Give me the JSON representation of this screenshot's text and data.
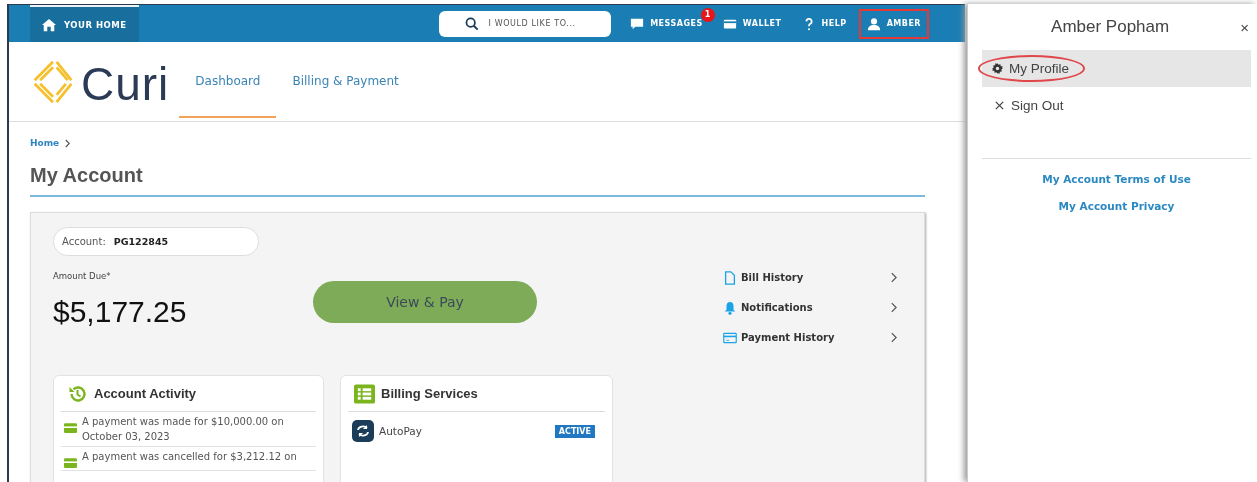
{
  "top_nav": {
    "home": "YOUR HOME",
    "search": {
      "placeholder": "I WOULD LIKE TO..."
    },
    "items": [
      {
        "kind": "messages",
        "label": "MESSAGES",
        "badge": "1",
        "annotated": false
      },
      {
        "kind": "wallet",
        "label": "WALLET",
        "annotated": false
      },
      {
        "kind": "help",
        "label": "HELP",
        "annotated": false
      },
      {
        "kind": "user",
        "label": "AMBER",
        "annotated": true
      }
    ]
  },
  "header": {
    "logo": "Curi",
    "tabs": [
      {
        "label": "Dashboard",
        "selected": true
      },
      {
        "label": "Billing & Payment",
        "selected": false
      }
    ]
  },
  "breadcrumb": [
    "Home"
  ],
  "page_title": "My Account",
  "account": {
    "label": "Account:",
    "number": "PG122845",
    "amount_label": "Amount Due*",
    "amount": "$5,177.25",
    "pay_button": "View & Pay",
    "links": [
      {
        "kind": "bill",
        "label": "Bill History"
      },
      {
        "kind": "bell",
        "label": "Notifications"
      },
      {
        "kind": "card",
        "label": "Payment History"
      }
    ]
  },
  "activity": {
    "title": "Account Activity",
    "items": [
      "A payment was made for $10,000.00 on October 03, 2023",
      "A payment was cancelled for $3,212.12 on"
    ]
  },
  "billing_services": {
    "title": "Billing Services",
    "items": [
      {
        "label": "AutoPay",
        "status": "ACTIVE"
      }
    ]
  },
  "user_panel": {
    "title": "Amber Popham",
    "close": "×",
    "menu": [
      {
        "kind": "profile",
        "label": "My Profile",
        "selected": true,
        "annotated": true
      },
      {
        "kind": "signout",
        "label": "Sign Out",
        "selected": false,
        "annotated": false
      }
    ],
    "links": [
      "My Account Terms of Use",
      "My Account Privacy"
    ]
  }
}
